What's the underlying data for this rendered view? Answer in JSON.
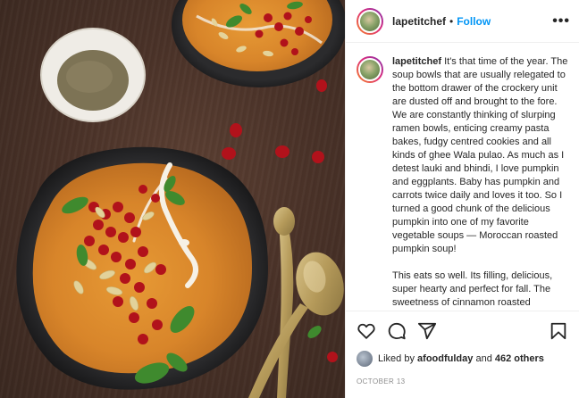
{
  "header": {
    "username": "lapetitchef",
    "separator": "•",
    "follow_label": "Follow",
    "more_icon": "more-options-icon",
    "more_label": "•••"
  },
  "caption": {
    "username": "lapetitchef",
    "text": "It's that time of the year. The soup bowls that are usually relegated to the bottom drawer of the crockery unit are dusted off and brought to the fore. We are constantly thinking of slurping ramen bowls, enticing creamy pasta bakes, fudgy centred cookies and all kinds of ghee Wala pulao. As much as I detest lauki and bhindi, I love pumpkin and eggplants. Baby has pumpkin and carrots twice daily and loves it too. So I turned a good chunk of the delicious pumpkin into one of my favorite vegetable soups — Moroccan roasted pumpkin soup!\n\nThis eats so well. Its filling, delicious, super hearty and perfect for fall. The sweetness of cinnamon roasted"
  },
  "actions": {
    "icons": [
      "heart-icon",
      "comment-icon",
      "share-icon",
      "bookmark-icon"
    ]
  },
  "likes": {
    "prefix": "Liked by",
    "user": "afoodfulday",
    "middle": "and",
    "count": "462 others"
  },
  "date": "OCTOBER 13",
  "colors": {
    "follow": "#0095f6",
    "text": "#262626",
    "muted": "#8e8e8e",
    "soup": "#d98a2b",
    "pomegranate": "#b1121b",
    "mint": "#3f8a2e"
  }
}
